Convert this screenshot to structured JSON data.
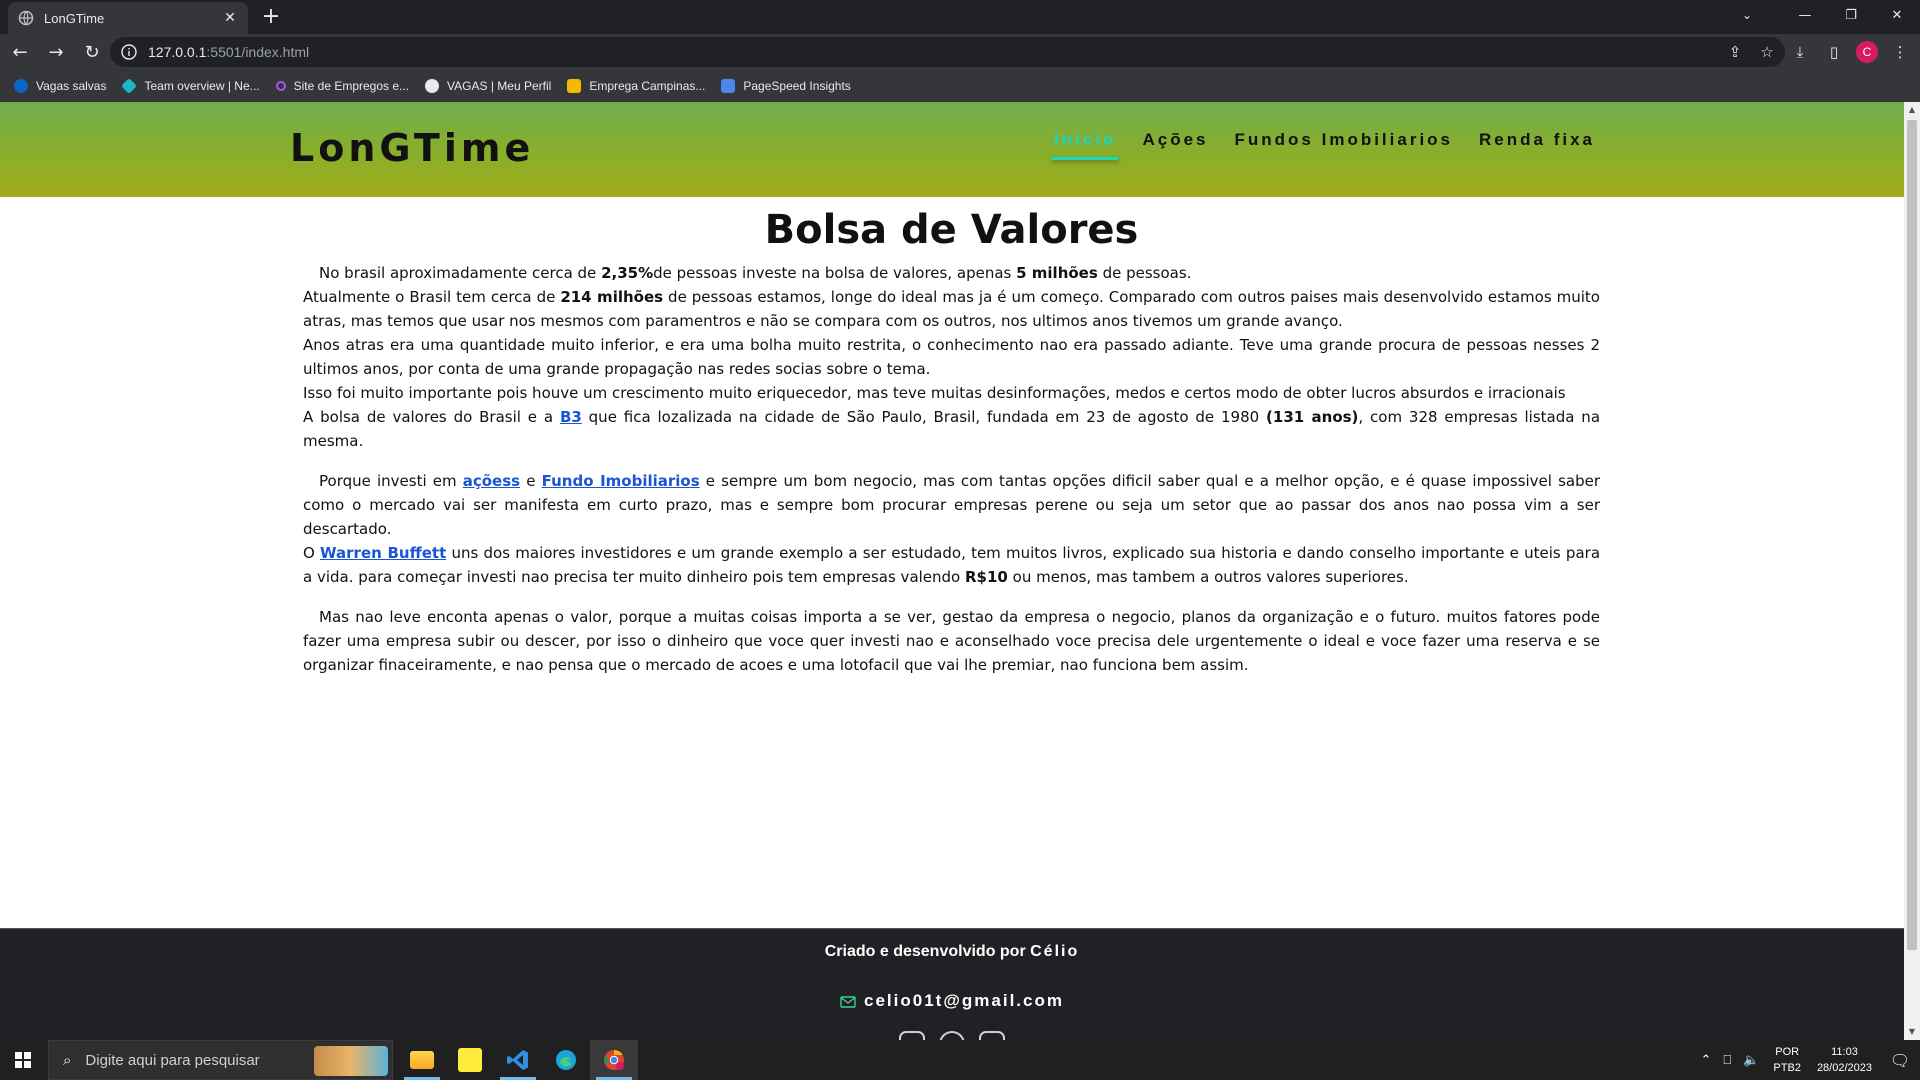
{
  "browser": {
    "tab_title": "LonGTime",
    "tab_close": "✕",
    "new_tab": "+",
    "url_host": "127.0.0.1",
    "url_rest": ":5501/index.html",
    "bookmarks": [
      {
        "label": "Vagas salvas",
        "color": "#0a66c2"
      },
      {
        "label": "Team overview | Ne...",
        "color": "#1fb5c9"
      },
      {
        "label": "Site de Empregos e...",
        "color": "#a855f7"
      },
      {
        "label": "VAGAS | Meu Perfil",
        "color": "#e8eaed"
      },
      {
        "label": "Emprega Campinas...",
        "color": "#f5b800"
      },
      {
        "label": "PageSpeed Insights",
        "color": "#4f86ec"
      }
    ],
    "profile_initial": "C"
  },
  "site": {
    "logo": "LonGTime",
    "nav": [
      {
        "label": "Inicio",
        "active": true
      },
      {
        "label": "Ações",
        "active": false
      },
      {
        "label": "Fundos Imobiliarios",
        "active": false
      },
      {
        "label": "Renda fixa",
        "active": false
      }
    ],
    "title": "Bolsa de Valores",
    "p1": {
      "a": "No brasil aproximadamente cerca de ",
      "b": "2,35%",
      "c": "de pessoas investe na bolsa de valores, apenas ",
      "d": "5 milhões",
      "e": " de pessoas."
    },
    "p2": {
      "a": "Atualmente o Brasil tem cerca de ",
      "b": "214 milhões",
      "c": " de pessoas estamos, longe do ideal mas ja é um começo. Comparado com outros paises mais desenvolvido estamos muito atras, mas temos que usar nos mesmos com paramentros e não se compara com os outros, nos ultimos anos tivemos um grande avanço."
    },
    "p3": "Anos atras era uma quantidade muito inferior, e era uma bolha muito restrita, o conhecimento nao era passado adiante. Teve uma grande procura de pessoas nesses 2 ultimos anos, por conta de uma grande propagação nas redes socias sobre o tema.",
    "p4": "Isso foi muito importante pois houve um crescimento muito eriquecedor, mas teve muitas desinformações, medos e certos modo de obter lucros absurdos e irracionais",
    "p5": {
      "a": "A bolsa de valores do Brasil e a ",
      "link": "B3",
      "b": " que fica lozalizada na cidade de São Paulo, Brasil, fundada em 23 de agosto de 1980 ",
      "c": "(131 anos)",
      "d": ", com 328 empresas listada na mesma."
    },
    "p6": {
      "a": "Porque investi em ",
      "link1": "açõess",
      "b": " e ",
      "link2": "Fundo Imobiliarios",
      "c": " e sempre um bom negocio, mas com tantas opções dificil saber qual e a melhor opção, e é quase impossivel saber como o mercado vai ser manifesta em curto prazo, mas e sempre bom procurar empresas perene ou seja um setor que ao passar dos anos nao possa vim a ser descartado."
    },
    "p7": {
      "a": "O ",
      "link": "Warren Buffett",
      "b": " uns dos maiores investidores e um grande exemplo a ser estudado, tem muitos livros, explicado sua historia e dando conselho importante e uteis para a vida. para começar investi nao precisa ter muito dinheiro pois tem empresas valendo ",
      "c": "R$10",
      "d": " ou menos, mas tambem a outros valores superiores."
    },
    "p8": "Mas nao leve enconta apenas o valor, porque a muitas coisas importa a se ver, gestao da empresa o negocio, planos da organização e o futuro. muitos fatores pode fazer uma empresa subir ou descer, por isso o dinheiro que voce quer investi nao e aconselhado voce precisa dele urgentemente o ideal e voce fazer uma reserva e se organizar finaceiramente, e nao pensa que o mercado de acoes e uma lotofacil que vai lhe premiar, nao funciona bem assim.",
    "footer_credit": "Criado e desenvolvido por ",
    "footer_name": "Célio",
    "footer_email": "celio01t@gmail.com"
  },
  "taskbar": {
    "search_placeholder": "Digite aqui para pesquisar",
    "lang_1": "POR",
    "lang_2": "PTB2",
    "time": "11:03",
    "date": "28/02/2023"
  }
}
